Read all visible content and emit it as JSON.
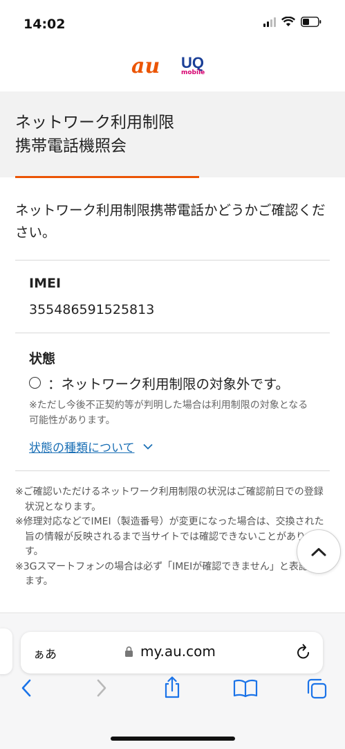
{
  "status_bar": {
    "time": "14:02"
  },
  "brand": {
    "au": "au",
    "uq": "UQ",
    "uq_sub": "mobile"
  },
  "page": {
    "title_line1": "ネットワーク利用制限",
    "title_line2": "携帯電話機照会",
    "lead": "ネットワーク利用制限携帯電話かどうかご確認ください。"
  },
  "imei": {
    "label": "IMEI",
    "value": "355486591525813"
  },
  "status": {
    "label": "状態",
    "value": "：ネットワーク利用制限の対象外です。",
    "note": "※ただし今後不正契約等が判明した場合は利用制限の対象となる可能性があります。",
    "link": "状態の種類について"
  },
  "footnotes": [
    "※ご確認いただけるネットワーク利用制限の状況はご確認前日での登録状況となります。",
    "※修理対応などでIMEI（製造番号）が変更になった場合は、交換された旨の情報が反映されるまで当サイトでは確認できないことがあります。",
    "※3Gスマートフォンの場合は必ず「IMEIが確認できません」と表記されます。"
  ],
  "browser": {
    "text_size": "ぁあ",
    "url": "my.au.com"
  },
  "colors": {
    "accent": "#eb5505",
    "link": "#1a6fb5",
    "uq": "#1a3f97"
  }
}
